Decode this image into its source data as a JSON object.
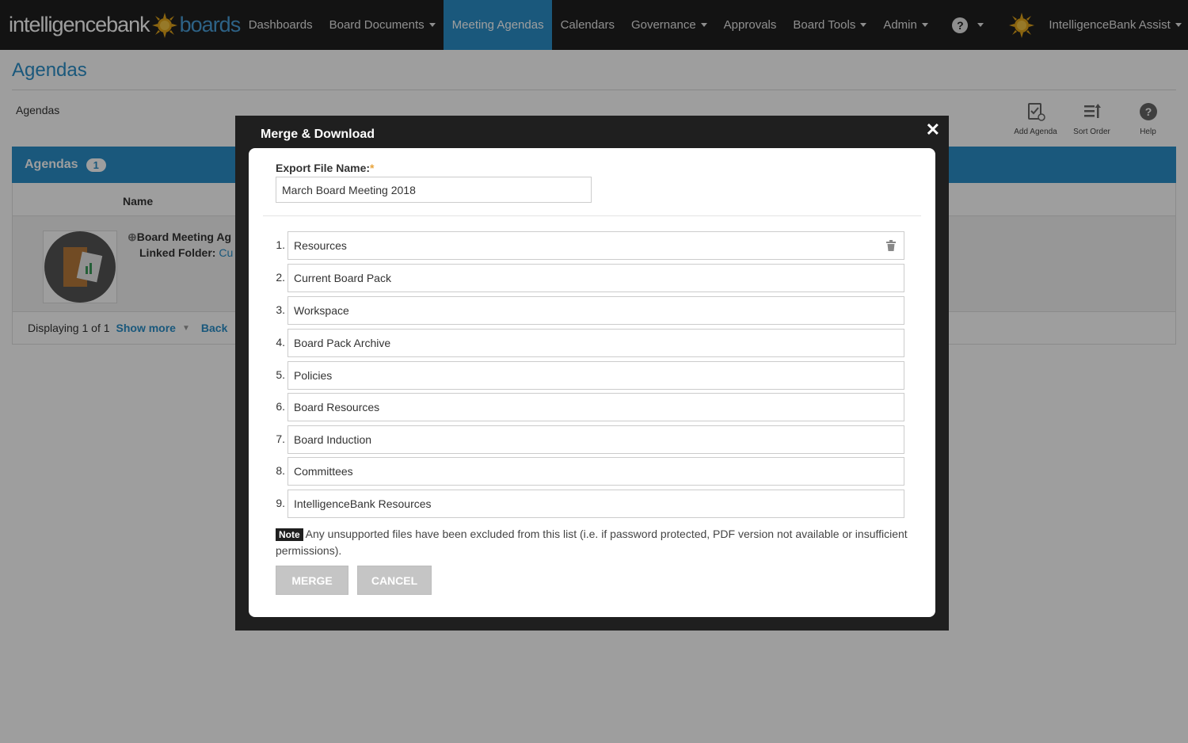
{
  "brand": {
    "part1": "intelligencebank",
    "part2": "boards"
  },
  "nav": {
    "items": [
      {
        "label": "Dashboards",
        "dropdown": false,
        "active": false
      },
      {
        "label": "Board Documents",
        "dropdown": true,
        "active": false
      },
      {
        "label": "Meeting Agendas",
        "dropdown": false,
        "active": true
      },
      {
        "label": "Calendars",
        "dropdown": false,
        "active": false
      },
      {
        "label": "Governance",
        "dropdown": true,
        "active": false
      },
      {
        "label": "Approvals",
        "dropdown": false,
        "active": false
      },
      {
        "label": "Board Tools",
        "dropdown": true,
        "active": false
      },
      {
        "label": "Admin",
        "dropdown": true,
        "active": false
      }
    ],
    "help": "?",
    "user": "IntelligenceBank Assist"
  },
  "page": {
    "title": "Agendas",
    "breadcrumb": "Agendas",
    "tools": [
      {
        "label": "Add Agenda",
        "icon": "add-agenda-icon"
      },
      {
        "label": "Sort Order",
        "icon": "sort-order-icon"
      },
      {
        "label": "Help",
        "icon": "help-icon"
      }
    ],
    "panel": {
      "title": "Agendas",
      "count": "1"
    },
    "column": "Name",
    "row": {
      "title": "Board Meeting Ag",
      "folder_label": "Linked Folder:",
      "folder_link": "Cu"
    },
    "footer": {
      "displaying": "Displaying 1 of 1",
      "show_more": "Show more",
      "back": "Back"
    }
  },
  "modal": {
    "title": "Merge & Download",
    "close": "✕",
    "field_label": "Export File Name:",
    "required_mark": "*",
    "file_name": "March Board Meeting 2018",
    "items": [
      {
        "num": "1.",
        "label": "Resources"
      },
      {
        "num": "2.",
        "label": "Current Board Pack"
      },
      {
        "num": "3.",
        "label": "Workspace"
      },
      {
        "num": "4.",
        "label": "Board Pack Archive"
      },
      {
        "num": "5.",
        "label": "Policies"
      },
      {
        "num": "6.",
        "label": "Board Resources"
      },
      {
        "num": "7.",
        "label": "Board Induction"
      },
      {
        "num": "8.",
        "label": "Committees"
      },
      {
        "num": "9.",
        "label": "IntelligenceBank Resources"
      }
    ],
    "note_tag": "Note",
    "note_text": "Any unsupported files have been excluded from this list (i.e. if password protected, PDF version not available or insufficient permissions).",
    "merge": "MERGE",
    "cancel": "CANCEL"
  },
  "colors": {
    "nav_bg": "#1f1f1f",
    "accent": "#2a8fc8",
    "button_disabled": "#c5c5c5",
    "required": "#e8a33c"
  }
}
